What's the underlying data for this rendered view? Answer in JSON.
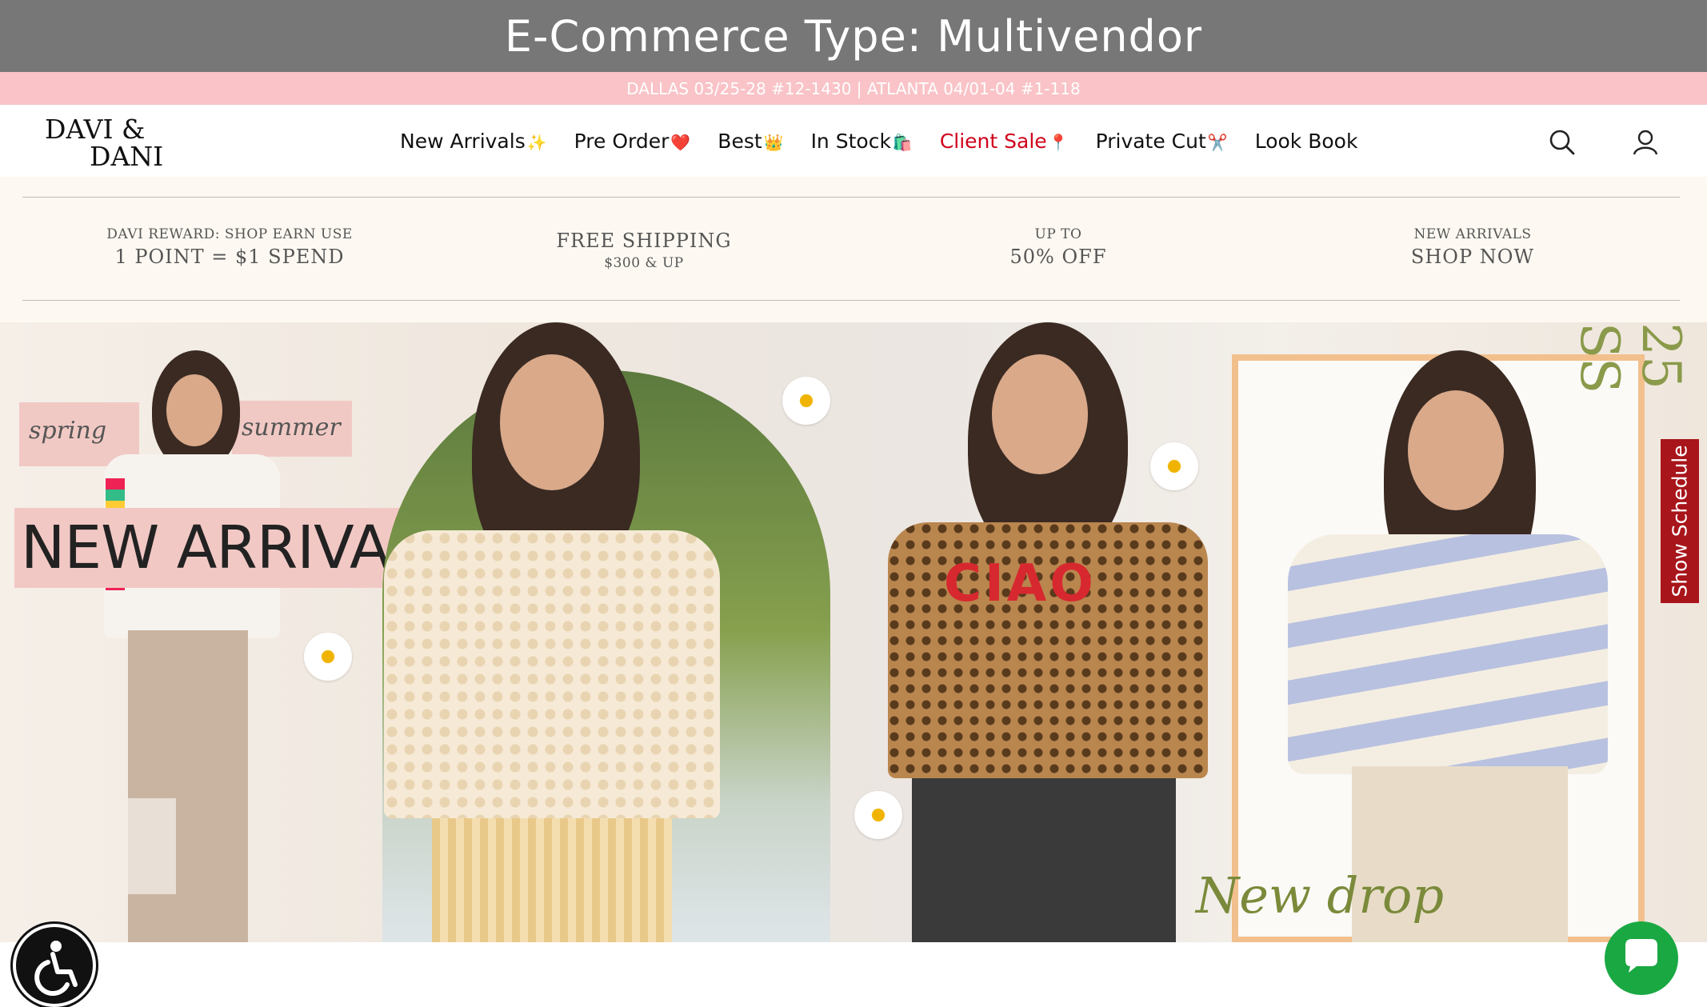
{
  "banner": {
    "text": "E-Commerce Type: Multivendor"
  },
  "promo": {
    "text": "DALLAS 03/25-28 #12-1430 | ATLANTA 04/01-04 #1-118"
  },
  "header": {
    "logo_line1": "DAVI &",
    "logo_line2": "DANI",
    "menu": [
      {
        "label": "New Arrivals",
        "emoji": "✨"
      },
      {
        "label": "Pre Order",
        "emoji": "❤️"
      },
      {
        "label": "Best",
        "emoji": "👑"
      },
      {
        "label": "In Stock",
        "emoji": "🛍️"
      },
      {
        "label": "Client Sale",
        "emoji": "📍"
      },
      {
        "label": "Private Cut",
        "emoji": "✂️"
      },
      {
        "label": "Look Book",
        "emoji": ""
      }
    ],
    "icons": [
      "search-icon",
      "user-icon"
    ]
  },
  "perks": [
    {
      "top": "DAVI REWARD: SHOP EARN USE",
      "main": "1 POINT = $1 SPEND",
      "bottom": ""
    },
    {
      "top": "",
      "main": "FREE SHIPPING",
      "bottom": "$300 & UP"
    },
    {
      "top": "UP TO",
      "main": "50% OFF",
      "bottom": ""
    },
    {
      "top": "NEW ARRIVALS",
      "main": "SHOP NOW",
      "bottom": ""
    }
  ],
  "hero": {
    "spring": "spring",
    "summer": "summer",
    "headline": "NEW ARRIVALS",
    "new_drop": "New drop",
    "season": "25 SS",
    "shirt_text": "CIAO"
  },
  "side_tab": {
    "label": "Show Schedule"
  },
  "colors": {
    "accent_red": "#d0021b",
    "promo_pink": "#f9c3c7",
    "schedule_red": "#a8151b",
    "chat_green": "#1aa843"
  }
}
